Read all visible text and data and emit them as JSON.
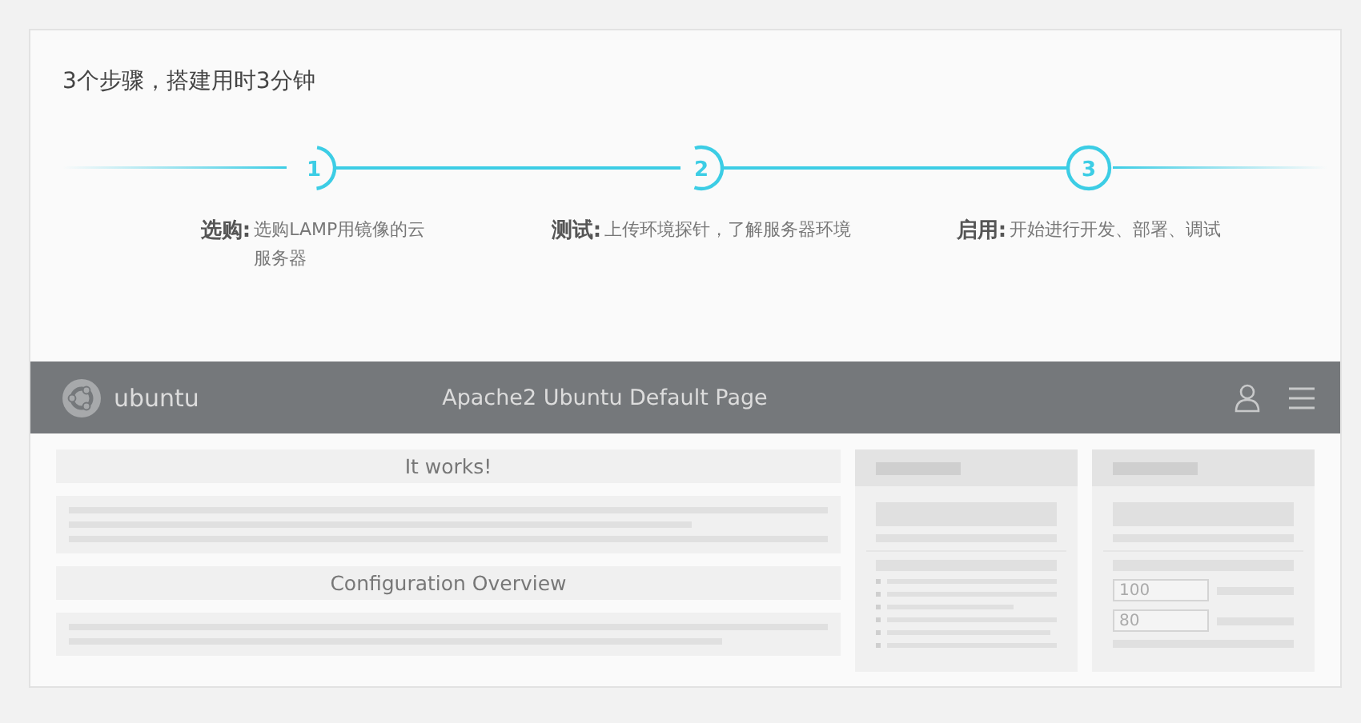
{
  "heading": "3个步骤，搭建用时3分钟",
  "steps": [
    {
      "number": "1",
      "title": "选购:",
      "description": "选购LAMP用镜像的云服务器",
      "selected": false
    },
    {
      "number": "2",
      "title": "测试:",
      "description": "上传环境探针，了解服务器环境",
      "selected": false
    },
    {
      "number": "3",
      "title": "启用:",
      "description": "开始进行开发、部署、调试",
      "selected": true
    }
  ],
  "preview": {
    "brand": "ubuntu",
    "title": "Apache2 Ubuntu Default Page",
    "sections": [
      "It works!",
      "Configuration Overview"
    ],
    "inputs": [
      "100",
      "80"
    ]
  }
}
